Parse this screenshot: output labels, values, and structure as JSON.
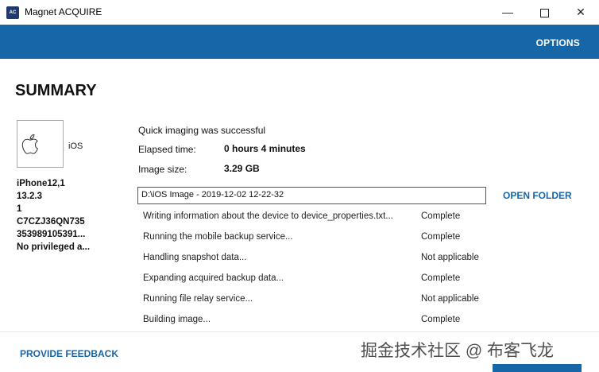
{
  "window": {
    "title": "Magnet ACQUIRE",
    "icon": "magnet-acquire-app-icon",
    "icon_text": "AC"
  },
  "controls": {
    "minimize": "—",
    "close": "✕"
  },
  "topbar": {
    "options_label": "OPTIONS",
    "color": "#1766a8"
  },
  "summary": {
    "title": "SUMMARY"
  },
  "device": {
    "icon": "apple-icon",
    "os": "iOS",
    "info": [
      "iPhone12,1",
      "13.2.3",
      "1",
      "C7CZJ36QN735",
      "353989105391...",
      "No privileged a..."
    ]
  },
  "result": {
    "status": "Quick imaging was successful",
    "elapsed_label": "Elapsed time:",
    "elapsed_value": "0 hours 4 minutes",
    "size_label": "Image size:",
    "size_value": "3.29 GB",
    "path": "D:\\iOS Image - 2019-12-02 12-22-32",
    "open_folder_label": "OPEN FOLDER"
  },
  "tasks": [
    {
      "desc": "Writing information about the device to device_properties.txt...",
      "status": "Complete"
    },
    {
      "desc": "Running the mobile backup service...",
      "status": "Complete"
    },
    {
      "desc": "Handling snapshot data...",
      "status": "Not applicable"
    },
    {
      "desc": "Expanding acquired backup data...",
      "status": "Complete"
    },
    {
      "desc": "Running file relay service...",
      "status": "Not applicable"
    },
    {
      "desc": "Building image...",
      "status": "Complete"
    }
  ],
  "footer": {
    "feedback_label": "PROVIDE FEEDBACK"
  },
  "watermark": "掘金技术社区 @ 布客飞龙"
}
